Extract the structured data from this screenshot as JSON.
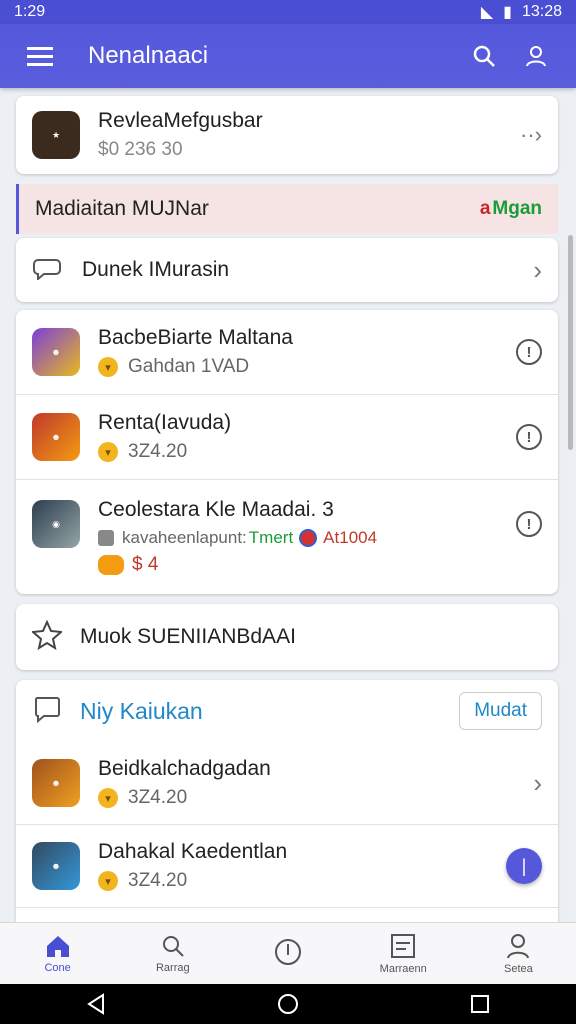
{
  "status_bar": {
    "time_left": "1:29",
    "time_right": "13:28"
  },
  "app_bar": {
    "title": "Nenalnaaci"
  },
  "top_app": {
    "name": "RevleaMefgusbar",
    "sub": "$0 236 30"
  },
  "banner": {
    "text": "Madiaitan MUJNar",
    "tag_prefix": "a",
    "tag": "Mgan"
  },
  "section_link": {
    "label": "Dunek IMurasin"
  },
  "games": [
    {
      "name": "BacbeBiarte Maltana",
      "meta": "Gahdan 1VAD"
    },
    {
      "name": "Renta(Iavuda)",
      "meta": "3Z4.20"
    },
    {
      "name": "Ceolestara Kle Maadai. 3",
      "meta": "kavaheenlapunt:",
      "meta_link": "Tmert",
      "meta_alert": "At1004",
      "price": "$ 4"
    }
  ],
  "favorites": {
    "label": "Muok SUENIIANBdAAI"
  },
  "news": {
    "title": "Niy Kaiukan",
    "button": "Mudat",
    "items": [
      {
        "name": "Beidkalchadgadan",
        "meta": "3Z4.20"
      },
      {
        "name": "Dahakal Kaedentlan",
        "meta": "3Z4.20"
      }
    ]
  },
  "bottom_nav": [
    {
      "label": "Cone",
      "icon": "home-icon"
    },
    {
      "label": "Rarrag",
      "icon": "search-icon"
    },
    {
      "label": "",
      "icon": "compass-icon"
    },
    {
      "label": "Marraenn",
      "icon": "list-icon"
    },
    {
      "label": "Setea",
      "icon": "person-icon"
    }
  ],
  "colors": {
    "primary": "#5558db",
    "banner_bg": "#f6e3e3",
    "link_blue": "#1e88c8"
  }
}
